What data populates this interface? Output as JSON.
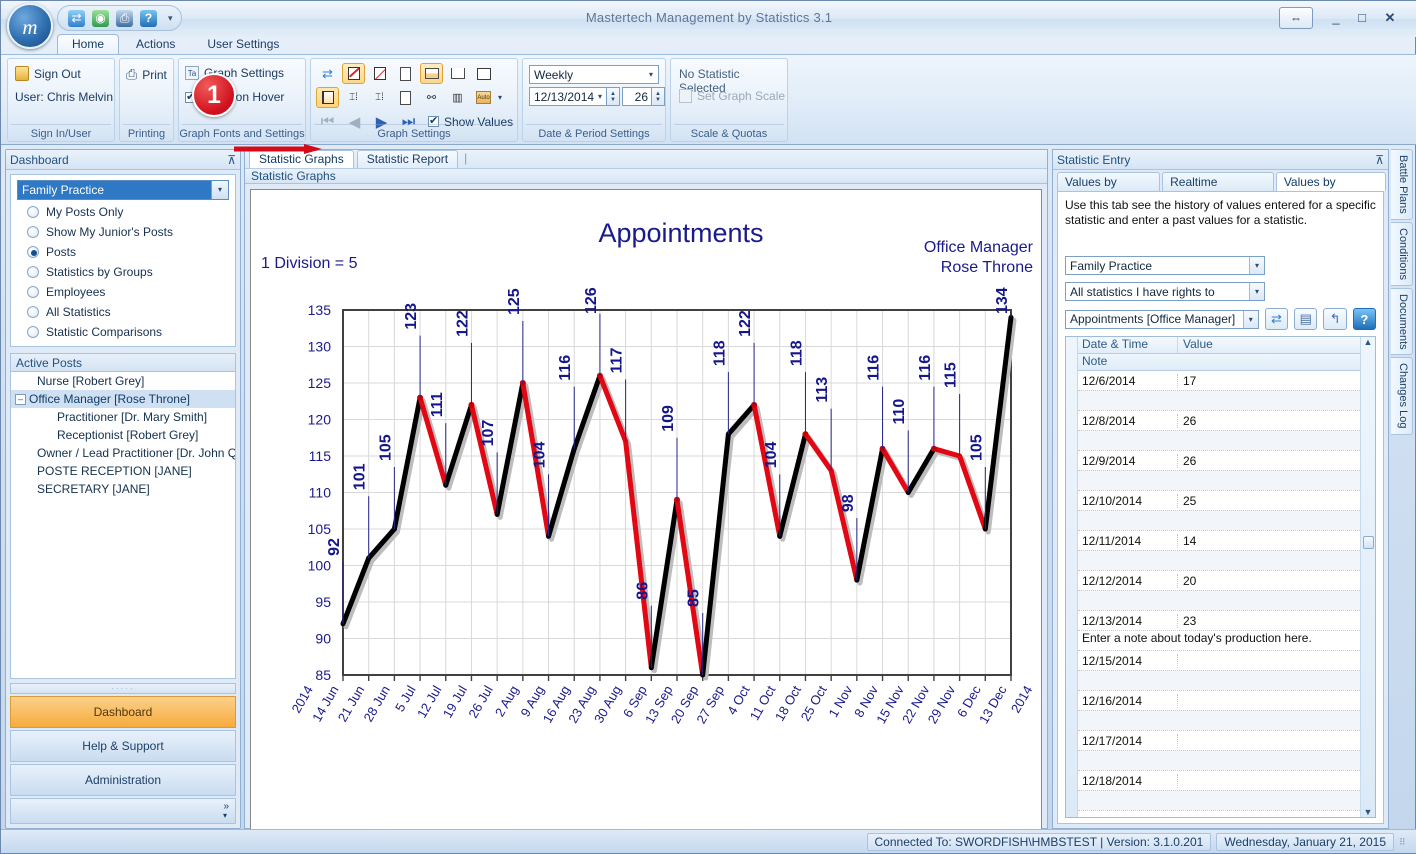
{
  "window": {
    "title": "Mastertech Management by Statistics 3.1",
    "minimize": "_",
    "maximize": "□",
    "close": "✕",
    "restore_ribbon_icon": "⇔"
  },
  "quick_access": {
    "orb_label": "m",
    "icons": [
      {
        "name": "refresh-icon",
        "glyph": "⇄",
        "color": "#2f7fd0"
      },
      {
        "name": "globe-icon",
        "glyph": "🌐",
        "color": "#2f9b4f"
      },
      {
        "name": "print-icon",
        "glyph": "⎙",
        "color": "#3a6ea5"
      },
      {
        "name": "help-icon",
        "glyph": "?",
        "color": "#1f6fb8"
      }
    ],
    "dropdown_glyph": "▾"
  },
  "ribbon": {
    "tabs": [
      {
        "label": "Home",
        "active": true
      },
      {
        "label": "Actions",
        "active": false
      },
      {
        "label": "User Settings",
        "active": false
      }
    ],
    "groups": {
      "sign_in": {
        "title": "Sign In/User",
        "sign_out": "Sign Out",
        "user_line": "User: Chris Melvin"
      },
      "printing": {
        "title": "Printing",
        "print": "Print"
      },
      "graph_fonts": {
        "title": "Graph Fonts and Settings",
        "graph_settings": "Graph Settings",
        "notes_on_hover": "Notes on Hover",
        "notes_checked": true
      },
      "graph_settings": {
        "title": "Graph Settings",
        "show_values_label": "Show Values",
        "show_values_checked": true,
        "auto_label": "Auto"
      },
      "date_period": {
        "title": "Date & Period Settings",
        "period": "Weekly",
        "date": "12/13/2014",
        "count": "26"
      },
      "scale_quotas": {
        "title": "Scale & Quotas",
        "no_stat": "No Statistic Selected",
        "set_scale": "Set Graph Scale"
      }
    }
  },
  "callout": {
    "number": "1"
  },
  "dashboard": {
    "header": "Dashboard",
    "pin": "⊼",
    "selected_practice": "Family Practice",
    "filters": [
      {
        "label": "My Posts Only",
        "selected": false
      },
      {
        "label": "Show My Junior's Posts",
        "selected": false
      },
      {
        "label": "Posts",
        "selected": true
      },
      {
        "label": "Statistics by Groups",
        "selected": false
      },
      {
        "label": "Employees",
        "selected": false
      },
      {
        "label": "All Statistics",
        "selected": false
      },
      {
        "label": "Statistic Comparisons",
        "selected": false
      }
    ],
    "active_posts_header": "Active Posts",
    "posts": [
      {
        "label": "Nurse [Robert Grey]",
        "indent": 1,
        "expander": false,
        "selected": false
      },
      {
        "label": "Office Manager [Rose Throne]",
        "indent": 0,
        "expander": true,
        "selected": true
      },
      {
        "label": "Practitioner  [Dr. Mary Smith]",
        "indent": 2,
        "expander": false,
        "selected": false
      },
      {
        "label": "Receptionist  [Robert Grey]",
        "indent": 2,
        "expander": false,
        "selected": false
      },
      {
        "label": "Owner / Lead Practitioner  [Dr. John Que]",
        "indent": 1,
        "expander": false,
        "selected": false
      },
      {
        "label": "POSTE RECEPTION [JANE]",
        "indent": 1,
        "expander": false,
        "selected": false
      },
      {
        "label": "SECRETARY [JANE]",
        "indent": 1,
        "expander": false,
        "selected": false
      }
    ],
    "nav": [
      {
        "label": "Dashboard",
        "active": true
      },
      {
        "label": "Help & Support",
        "active": false
      },
      {
        "label": "Administration",
        "active": false
      }
    ],
    "more_glyph": "»",
    "more_chev": "▾"
  },
  "center": {
    "tabs": [
      {
        "label": "Statistic Graphs",
        "active": true
      },
      {
        "label": "Statistic Report",
        "active": false
      }
    ],
    "sub_header": "Statistic Graphs"
  },
  "chart_data": {
    "type": "line",
    "title": "Appointments",
    "annotation_division": "1 Division = 5",
    "corner_label_line1": "Office Manager",
    "corner_label_line2": "Rose Throne",
    "xlabel": "",
    "ylabel": "",
    "ylim": [
      85,
      135
    ],
    "yticks": [
      85,
      90,
      95,
      100,
      105,
      110,
      115,
      120,
      125,
      130,
      135
    ],
    "grid": true,
    "legend": "none",
    "value_labels_shown": true,
    "categories": [
      "2014",
      "14 Jun",
      "21 Jun",
      "28 Jun",
      "5 Jul",
      "12 Jul",
      "19 Jul",
      "26 Jul",
      "2 Aug",
      "9 Aug",
      "16 Aug",
      "23 Aug",
      "30 Aug",
      "6 Sep",
      "13 Sep",
      "20 Sep",
      "27 Sep",
      "4 Oct",
      "11 Oct",
      "18 Oct",
      "25 Oct",
      "1 Nov",
      "8 Nov",
      "15 Nov",
      "22 Nov",
      "29 Nov",
      "6 Dec",
      "13 Dec",
      "2014"
    ],
    "values": [
      92,
      101,
      105,
      123,
      111,
      122,
      107,
      125,
      104,
      116,
      126,
      117,
      86,
      109,
      85,
      118,
      122,
      104,
      118,
      113,
      98,
      116,
      110,
      116,
      115,
      105,
      134
    ],
    "series": [
      {
        "name": "Appointments",
        "color": "#000000",
        "values": [
          92,
          101,
          105,
          123,
          111,
          122,
          107,
          125,
          104,
          116,
          126,
          117,
          86,
          109,
          85,
          118,
          122,
          104,
          118,
          113,
          98,
          116,
          110,
          116,
          115,
          105,
          134
        ]
      }
    ],
    "segment_colors": {
      "rising": "#000000",
      "falling": "#e30613"
    }
  },
  "statistic_entry": {
    "header": "Statistic Entry",
    "pin": "⊼",
    "tabs": [
      {
        "label": "Values by Period",
        "active": false
      },
      {
        "label": "Realtime Statistics",
        "active": false
      },
      {
        "label": "Values by Statistic",
        "active": true
      }
    ],
    "help_text": "Use this tab see the history of values entered for a specific statistic and enter a past values for a statistic.",
    "combo_practice": "Family Practice",
    "combo_rights": "All statistics I have rights to",
    "combo_statistic": "Appointments [Office Manager]",
    "action_icons": [
      {
        "name": "refresh-icon",
        "glyph": "⇄"
      },
      {
        "name": "save-icon",
        "glyph": "💾"
      },
      {
        "name": "export-icon",
        "glyph": "↰"
      },
      {
        "name": "help-icon",
        "glyph": "?"
      }
    ],
    "grid": {
      "columns": [
        "Date & Time",
        "Value"
      ],
      "note_header": "Note",
      "scroll_up": "▲",
      "scroll_down": "▼",
      "rows": [
        {
          "date": "12/6/2014",
          "value": "17",
          "note": ""
        },
        {
          "date": "12/8/2014",
          "value": "26",
          "note": ""
        },
        {
          "date": "12/9/2014",
          "value": "26",
          "note": ""
        },
        {
          "date": "12/10/2014",
          "value": "25",
          "note": ""
        },
        {
          "date": "12/11/2014",
          "value": "14",
          "note": ""
        },
        {
          "date": "12/12/2014",
          "value": "20",
          "note": ""
        },
        {
          "date": "12/13/2014",
          "value": "23",
          "note": "Enter a note about today's production here."
        },
        {
          "date": "12/15/2014",
          "value": "",
          "note": ""
        },
        {
          "date": "12/16/2014",
          "value": "",
          "note": ""
        },
        {
          "date": "12/17/2014",
          "value": "",
          "note": ""
        },
        {
          "date": "12/18/2014",
          "value": "",
          "note": ""
        }
      ]
    }
  },
  "side_tabs": [
    {
      "label": "Battle Plans"
    },
    {
      "label": "Conditions"
    },
    {
      "label": "Documents"
    },
    {
      "label": "Changes Log"
    }
  ],
  "statusbar": {
    "connection": "Connected To: SWORDFISH\\HMBSTEST | Version: 3.1.0.201",
    "date": "Wednesday, January 21, 2015"
  }
}
